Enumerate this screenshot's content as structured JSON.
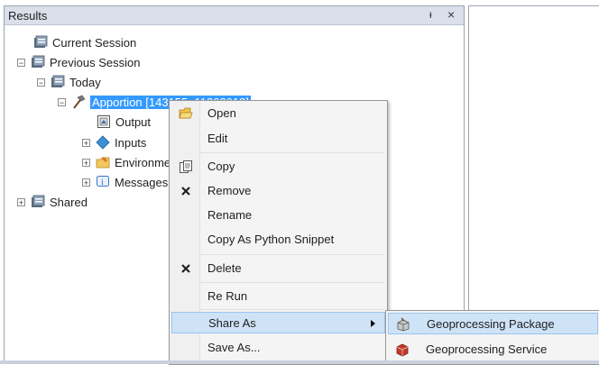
{
  "panel": {
    "title": "Results",
    "pin_glyph": "ᵻ",
    "close_glyph": "×"
  },
  "tree": {
    "current_session": "Current Session",
    "previous_session": "Previous Session",
    "today": "Today",
    "apportion": "Apportion [143155_11202013]",
    "output": "Output",
    "inputs": "Inputs",
    "environments": "Environments",
    "messages": "Messages",
    "shared": "Shared"
  },
  "context_menu": {
    "items": [
      {
        "label": "Open",
        "icon": "folder-open-icon"
      },
      {
        "label": "Edit",
        "icon": ""
      },
      {
        "label": "Copy",
        "icon": "copy-icon"
      },
      {
        "label": "Remove",
        "icon": "x-icon"
      },
      {
        "label": "Rename",
        "icon": ""
      },
      {
        "label": "Copy As Python Snippet",
        "icon": ""
      },
      {
        "label": "Delete",
        "icon": "x-icon"
      },
      {
        "label": "Re Run",
        "icon": ""
      },
      {
        "label": "Share As",
        "icon": "",
        "highlighted": true,
        "has_submenu": true
      },
      {
        "label": "Save As...",
        "icon": ""
      }
    ]
  },
  "submenu": {
    "items": [
      {
        "label": "Geoprocessing Package",
        "icon": "package-icon",
        "highlighted": true
      },
      {
        "label": "Geoprocessing Service",
        "icon": "service-icon"
      }
    ]
  },
  "colors": {
    "selection": "#3399ff",
    "menu_highlight": "#cfe3f7",
    "header": "#d9e0ea"
  }
}
